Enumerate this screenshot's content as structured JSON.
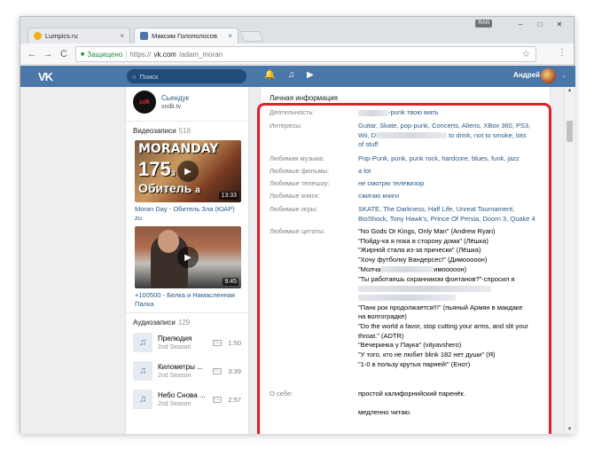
{
  "browser": {
    "lang_badge": "RAN",
    "tabs": [
      {
        "label": "Lumpics.ru",
        "favicon_color": "#f2b01e"
      },
      {
        "label": "Максим Голополосов",
        "favicon_color": "#4a76a8"
      }
    ],
    "close_glyph": "×",
    "window_controls": {
      "minimize": "–",
      "maximize": "□",
      "close": "✕"
    },
    "nav": {
      "back": "←",
      "forward": "→",
      "reload": "C"
    },
    "address": {
      "secure_label": "Защищено",
      "separator": "|",
      "scheme": "https://",
      "host": "vk.com",
      "path": "/adam_moran"
    },
    "star": "☆",
    "menu": "⋮"
  },
  "vk": {
    "logo": "VK",
    "search_placeholder": "Поиск",
    "user_name": "Андрей",
    "brand_color": "#4a76a8",
    "header_icons": {
      "bell": "🔔",
      "music": "♫",
      "video": "▶"
    },
    "chevron": "⌄"
  },
  "sidebar": {
    "community": {
      "logo_text": "sdk",
      "name": "Сьендук",
      "sub": "sndk.tv"
    },
    "videos": {
      "label": "Видеозаписи",
      "count": "518",
      "items": [
        {
          "cap1": "MORANDAY",
          "cap2": "175",
          "cap2_sup": "з",
          "cap3": "Обитель",
          "cap3_sup": "а",
          "duration": "13:33",
          "title": "Moran Day - Обитель Зла (ЮАР) zu"
        },
        {
          "duration": "9:45",
          "title": "+100500 - Белка и Намасленная Палка"
        }
      ]
    },
    "audio": {
      "label": "Аудиозаписи",
      "count": "129",
      "tracks": [
        {
          "title": "Прелюдия",
          "artist": "2nd Season",
          "time": "1:50"
        },
        {
          "title": "Километры ...",
          "artist": "2nd Season",
          "time": "3:39"
        },
        {
          "title": "Небо Снова ...",
          "artist": "2nd Season",
          "time": "2:57"
        }
      ]
    },
    "play_glyph": "▶",
    "note_glyph": "♫",
    "cc_glyph": "CC"
  },
  "info": {
    "title": "Личная информация",
    "activity": {
      "label": "Деятельность:",
      "value": "-punk твою мать"
    },
    "interests": {
      "label": "Интересы:",
      "value_line1": "Guitar, Skate, pop-punk, Concerts, Aliens, XBox 360, PS3,",
      "value_line2a": "Wii, D",
      "value_line2b": "to drink, not to smoke, lots",
      "value_line3": "of stuff"
    },
    "music": {
      "label": "Любимая музыка:",
      "value": "Pop-Punk, punk, punk rock, hardcore, blues, funk, jazz"
    },
    "films": {
      "label": "Любимые фильмы:",
      "value": "a lot"
    },
    "tv": {
      "label": "Любимые телешоу:",
      "value": "не смотрю телевизор"
    },
    "books": {
      "label": "Любимые книги:",
      "value": "сжигаю книги"
    },
    "games": {
      "label": "Любимые игры:",
      "value_line1": "SKATE, The Darkness, Half Life, Unreal Tournament,",
      "value_line2": "BioShock, Tony Hawk's, Prince Of Persia, Doorn 3, Quake 4"
    },
    "quotes": {
      "label": "Любимые цитаты:",
      "lines": [
        "\"No Gods Or Kings, Only Man\" (Andrew Ryan)",
        "\"Пойду-ка я пока в сторону дома\" (Лёшка)",
        "\"Жирной стала из-за прически\" (Лёшка)",
        "\"Хочу футболку Вандерсес!\" (Димоооoон)",
        "\"Молча",
        "имоооoон)",
        "\"Ты работаешь охранником фонтанов?\"-спросил я",
        "",
        "",
        "\"Панк рок продолжается!!!\" (пьяный Армян в макдаке",
        "на волгоградке)",
        "\"Do the world a favor, stop cutting your arms, and slit your",
        "throat.\" (ADTR)",
        "\"Вечеринка у Паука\" (vityavshero)",
        "\"У того, кто не любит blink 182 нет души\" (Я)",
        "\"1-0 в пользу крутых парней!\" (Енот)"
      ]
    },
    "about": {
      "label": "О себе:",
      "line1": "простой калифорнийский паренёк.",
      "line2": "медленно читаю."
    },
    "highlight_color": "#e02228"
  },
  "scrollbar": {
    "up": "▲",
    "down": "▼"
  }
}
